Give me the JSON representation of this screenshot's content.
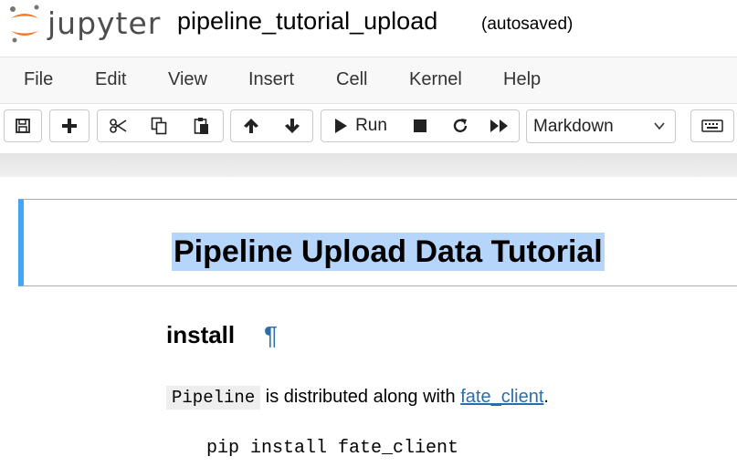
{
  "header": {
    "logo_text": "jupyter",
    "notebook_title": "pipeline_tutorial_upload",
    "autosave_status": "(autosaved)"
  },
  "menubar": {
    "items": [
      {
        "label": "File"
      },
      {
        "label": "Edit"
      },
      {
        "label": "View"
      },
      {
        "label": "Insert"
      },
      {
        "label": "Cell"
      },
      {
        "label": "Kernel"
      },
      {
        "label": "Help"
      }
    ]
  },
  "toolbar": {
    "buttons": [
      {
        "icon": "save-icon"
      },
      {
        "icon": "plus-icon"
      },
      {
        "icon": "cut-icon"
      },
      {
        "icon": "copy-icon"
      },
      {
        "icon": "paste-icon"
      },
      {
        "icon": "arrow-up-icon"
      },
      {
        "icon": "arrow-down-icon"
      },
      {
        "icon": "play-icon",
        "label": "Run"
      },
      {
        "icon": "stop-icon"
      },
      {
        "icon": "restart-icon"
      },
      {
        "icon": "fast-forward-icon"
      },
      {
        "icon": "keyboard-icon"
      }
    ],
    "cell_type": "Markdown"
  },
  "notebook": {
    "heading1": "Pipeline Upload Data Tutorial",
    "heading2": "install",
    "anchor_symbol": "¶",
    "paragraph": {
      "code": "Pipeline",
      "text": " is distributed along with ",
      "link": "fate_client",
      "end": "."
    },
    "code_block": "pip install fate_client"
  },
  "colors": {
    "selected_cell_border": "#42a5f5",
    "heading_highlight": "#b5d5fb",
    "link": "#296eaa",
    "logo_orange": "#f37726"
  }
}
